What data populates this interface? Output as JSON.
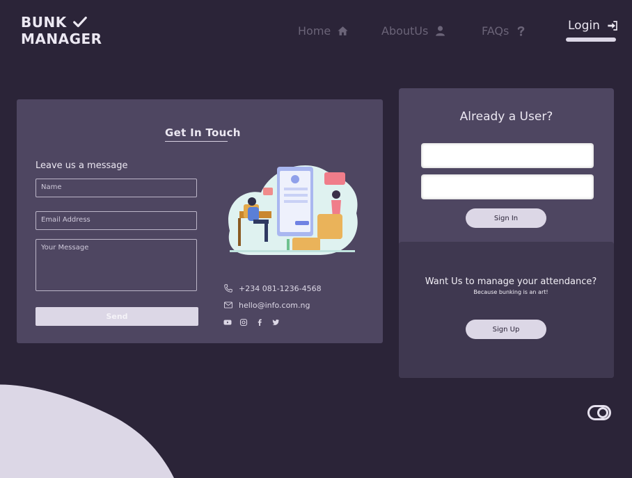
{
  "brand": {
    "line1": "BUNK",
    "line2": "MANAGER"
  },
  "nav": {
    "home": "Home",
    "about": "AboutUs",
    "faqs": "FAQs",
    "login": "Login"
  },
  "contact": {
    "title": "Get In Touch",
    "subtitle": "Leave us a message",
    "name_placeholder": "Name",
    "email_placeholder": "Email Address",
    "message_placeholder": "Your Message",
    "send_label": "Send",
    "phone": "+234 081-1236-4568",
    "email": "hello@info.com.ng"
  },
  "login_panel": {
    "heading": "Already a User?",
    "username_value": "",
    "password_value": "",
    "signin_label": "Sign In"
  },
  "signup_panel": {
    "heading": "Want Us to manage your attendance?",
    "subheading": "Because bunking is an art!",
    "signup_label": "Sign Up"
  },
  "icons": {
    "check": "check-icon",
    "home": "home-icon",
    "user": "user-icon",
    "faq": "question-icon",
    "login": "sign-in-icon",
    "phone": "phone-icon",
    "mail": "mail-icon",
    "youtube": "youtube-icon",
    "instagram": "instagram-icon",
    "facebook": "facebook-icon",
    "twitter": "twitter-icon",
    "toggle": "toggle-icon"
  },
  "colors": {
    "background": "#2b2438",
    "card": "#4e4661",
    "card_dark": "#3f3850",
    "accent_light": "#dcd7e6"
  }
}
